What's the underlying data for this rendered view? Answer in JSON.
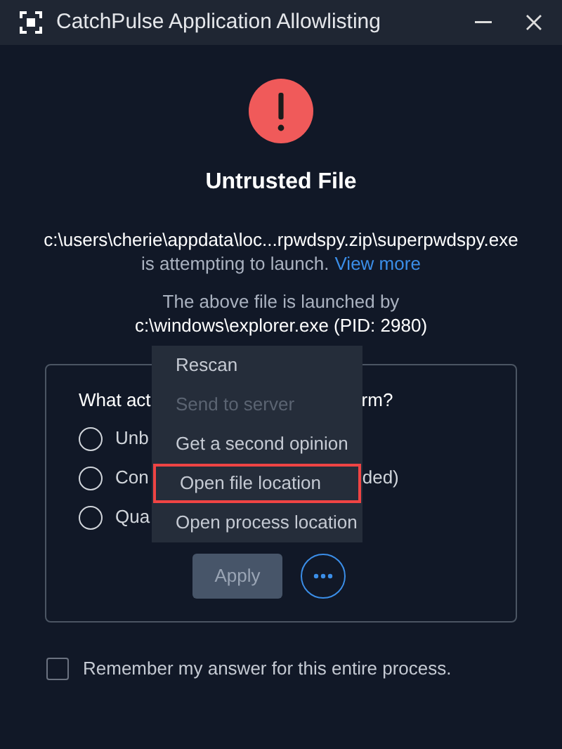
{
  "window": {
    "title": "CatchPulse Application Allowlisting"
  },
  "alert": {
    "title": "Untrusted File",
    "path": "c:\\users\\cherie\\appdata\\loc...rpwdspy.zip\\superpwdspy.exe",
    "message": "is attempting to launch.",
    "link": "View more",
    "launched_by": "The above file is launched by",
    "launcher": "c:\\windows\\explorer.exe (PID: 2980)"
  },
  "question": {
    "left": "What act",
    "right": "rm?"
  },
  "options": [
    {
      "left": "Unb",
      "selected": false
    },
    {
      "left": "Con",
      "right": "ded)",
      "selected": false
    },
    {
      "left": "Qua",
      "selected": false
    }
  ],
  "apply": {
    "label": "Apply",
    "disabled": true
  },
  "menu": [
    {
      "label": "Rescan",
      "disabled": false,
      "highlighted": false
    },
    {
      "label": "Send to server",
      "disabled": true,
      "highlighted": false
    },
    {
      "label": "Get a second opinion",
      "disabled": false,
      "highlighted": false
    },
    {
      "label": "Open file location",
      "disabled": false,
      "highlighted": true
    },
    {
      "label": "Open process location",
      "disabled": false,
      "highlighted": false
    }
  ],
  "remember": {
    "label": "Remember my answer for this entire process.",
    "checked": false
  }
}
